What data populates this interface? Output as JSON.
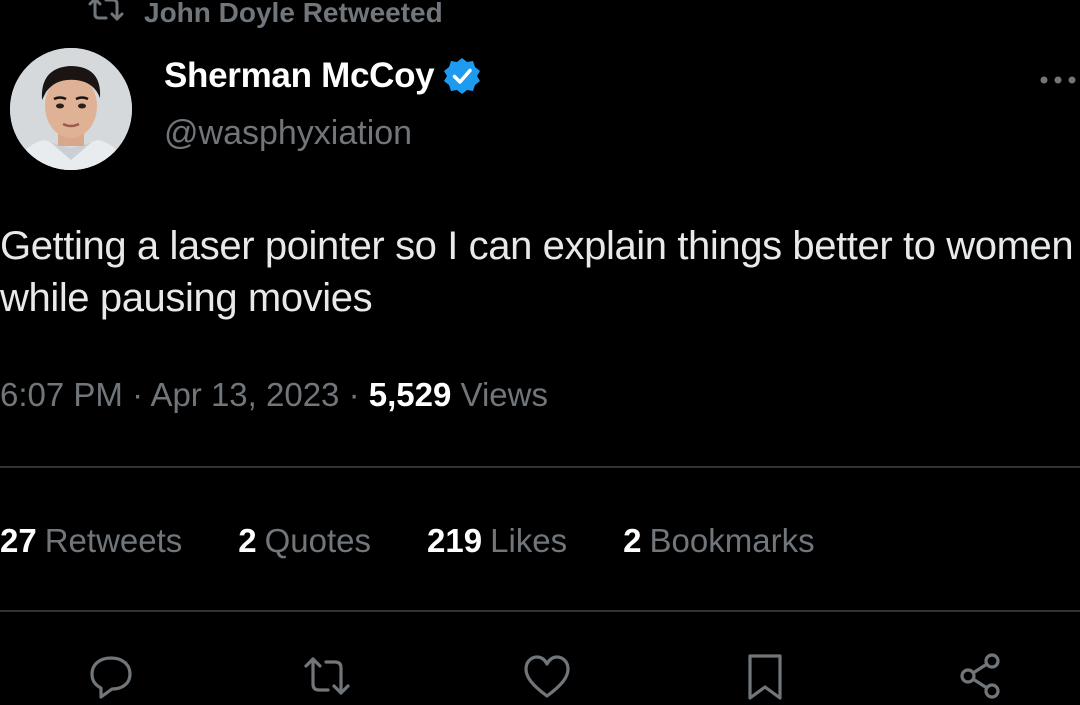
{
  "retweet_context": {
    "icon": "retweet-icon",
    "text": "John Doyle Retweeted"
  },
  "author": {
    "display_name": "Sherman McCoy",
    "handle": "@wasphyxiation",
    "verified_icon": "verified-badge-icon",
    "verified_color": "#1d9bf0"
  },
  "tweet": {
    "text": "Getting a laser pointer so I can explain things better to women while pausing movies",
    "time": "6:07 PM",
    "sep1": "·",
    "date": "Apr 13, 2023",
    "sep2": "·",
    "views_count": "5,529",
    "views_label": "Views"
  },
  "stats": {
    "retweets": {
      "count": "27",
      "label": "Retweets"
    },
    "quotes": {
      "count": "2",
      "label": "Quotes"
    },
    "likes": {
      "count": "219",
      "label": "Likes"
    },
    "bookmarks": {
      "count": "2",
      "label": "Bookmarks"
    }
  },
  "actions": [
    "reply-icon",
    "retweet-icon",
    "like-icon",
    "bookmark-icon",
    "share-icon"
  ],
  "colors": {
    "background": "#000000",
    "primary_text": "#e7e9ea",
    "secondary_text": "#71767b",
    "divider": "#2f3336",
    "accent": "#1d9bf0"
  }
}
